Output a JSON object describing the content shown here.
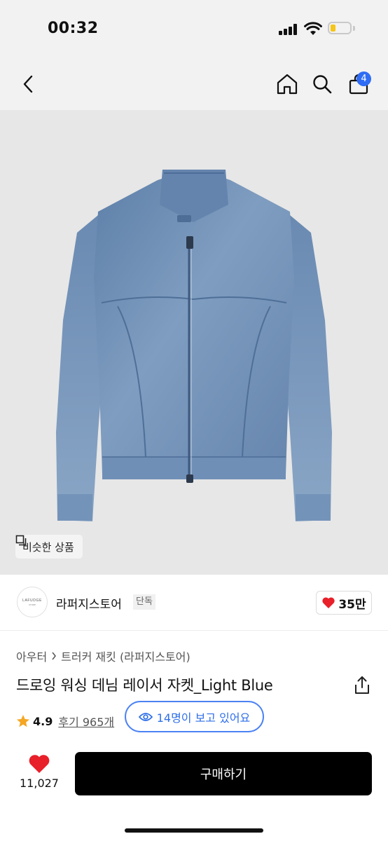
{
  "status_bar": {
    "time": "00:32"
  },
  "nav": {
    "cart_count": "4"
  },
  "product_image": {
    "similar_label": "비슷한 상품"
  },
  "store": {
    "name": "라퍼지스토어",
    "tag": "단독",
    "logo_text": "LAFUDGE",
    "logo_sub": "STORE",
    "likes": "35만"
  },
  "breadcrumb": [
    "아우터",
    "트러커 재킷 (라퍼지스토어)"
  ],
  "product": {
    "title": "드로잉 워싱 데님 레이서 자켓_Light Blue",
    "rating": "4.9",
    "reviews": "후기 965개",
    "viewing": "14명이 보고 있어요"
  },
  "action_bar": {
    "favorite_count": "11,027",
    "buy_label": "구매하기"
  },
  "colors": {
    "accent_blue": "#2e6cf5",
    "heart_red": "#e8202a",
    "star_orange": "#f5a623",
    "buy_button": "#000000"
  },
  "icons": [
    "back-icon",
    "home-icon",
    "search-icon",
    "cart-icon",
    "similar-icon",
    "heart-icon",
    "share-icon",
    "star-icon",
    "eye-icon"
  ]
}
